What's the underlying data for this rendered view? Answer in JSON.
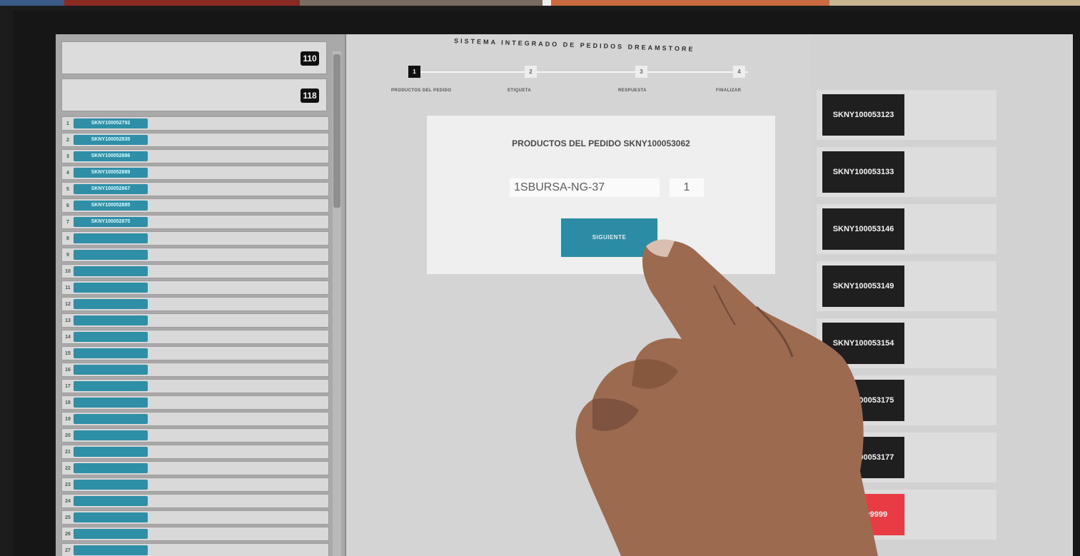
{
  "app": {
    "title": "SISTEMA INTEGRADO DE PEDIDOS DREAMSTORE"
  },
  "sidebar": {
    "headers": [
      {
        "label": "",
        "count": "110"
      },
      {
        "label": "",
        "count": "118"
      }
    ],
    "rows": [
      {
        "num": "1",
        "order": "SKNY100052792",
        "customer": ""
      },
      {
        "num": "2",
        "order": "SKNY100052835",
        "customer": ""
      },
      {
        "num": "3",
        "order": "SKNY100052886",
        "customer": ""
      },
      {
        "num": "4",
        "order": "SKNY100052889",
        "customer": ""
      },
      {
        "num": "5",
        "order": "SKNY100052867",
        "customer": ""
      },
      {
        "num": "6",
        "order": "SKNY100052885",
        "customer": ""
      },
      {
        "num": "7",
        "order": "SKNY100052875",
        "customer": ""
      },
      {
        "num": "8",
        "order": "",
        "customer": ""
      },
      {
        "num": "9",
        "order": "",
        "customer": ""
      },
      {
        "num": "10",
        "order": "",
        "customer": ""
      },
      {
        "num": "11",
        "order": "",
        "customer": ""
      },
      {
        "num": "12",
        "order": "",
        "customer": ""
      },
      {
        "num": "13",
        "order": "",
        "customer": ""
      },
      {
        "num": "14",
        "order": "",
        "customer": ""
      },
      {
        "num": "15",
        "order": "",
        "customer": ""
      },
      {
        "num": "16",
        "order": "",
        "customer": ""
      },
      {
        "num": "17",
        "order": "",
        "customer": ""
      },
      {
        "num": "18",
        "order": "",
        "customer": ""
      },
      {
        "num": "19",
        "order": "",
        "customer": ""
      },
      {
        "num": "20",
        "order": "",
        "customer": ""
      },
      {
        "num": "21",
        "order": "",
        "customer": ""
      },
      {
        "num": "22",
        "order": "",
        "customer": ""
      },
      {
        "num": "23",
        "order": "",
        "customer": ""
      },
      {
        "num": "24",
        "order": "",
        "customer": ""
      },
      {
        "num": "25",
        "order": "",
        "customer": ""
      },
      {
        "num": "26",
        "order": "",
        "customer": ""
      },
      {
        "num": "27",
        "order": "",
        "customer": ""
      }
    ]
  },
  "stepper": {
    "steps": [
      {
        "num": "1",
        "label": "PRODUCTOS DEL PEDIDO",
        "active": true
      },
      {
        "num": "2",
        "label": "ETIQUETA",
        "active": false
      },
      {
        "num": "3",
        "label": "RESPUESTA",
        "active": false
      },
      {
        "num": "4",
        "label": "FINALIZAR",
        "active": false
      }
    ]
  },
  "order_form": {
    "title": "PRODUCTOS DEL PEDIDO SKNY100053062",
    "subtitle": "",
    "sku_value": "1SBURSA-NG-37",
    "qty_value": "1",
    "next_label": "SIGUIENTE"
  },
  "queue": [
    {
      "order": "SKNY100053123",
      "client": "",
      "urgent": false
    },
    {
      "order": "SKNY100053133",
      "client": "",
      "urgent": false
    },
    {
      "order": "SKNY100053146",
      "client": "",
      "urgent": false
    },
    {
      "order": "SKNY100053149",
      "client": "",
      "urgent": false
    },
    {
      "order": "SKNY100053154",
      "client": "",
      "urgent": false
    },
    {
      "order": "SKNY100053175",
      "client": "",
      "urgent": false
    },
    {
      "order": "SKNY100053177",
      "client": "",
      "urgent": false
    },
    {
      "order": "SKNY999999",
      "client": "",
      "urgent": true
    }
  ],
  "colors": {
    "accent_teal": "#2c8ca6",
    "urgent_red": "#e83b43",
    "dark_box": "#1f1f1f"
  }
}
